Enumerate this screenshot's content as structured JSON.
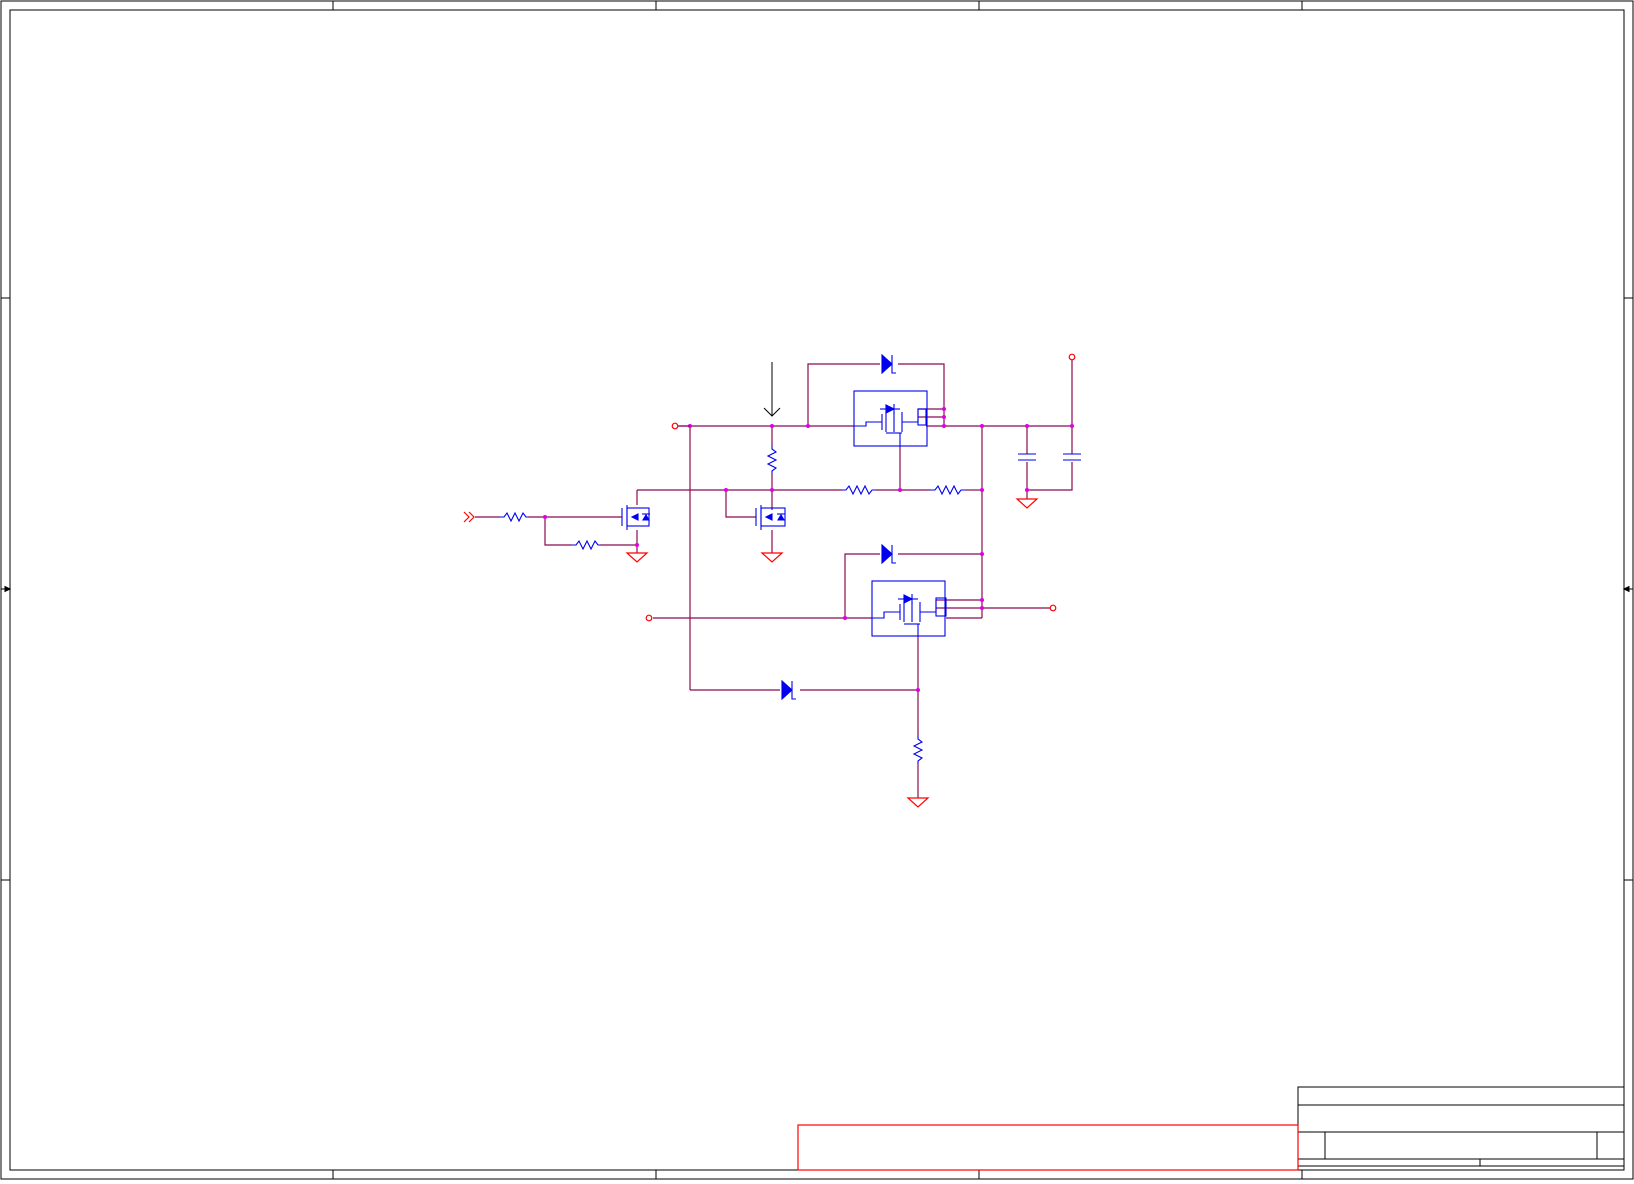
{
  "colors": {
    "wire": "#8b0a50",
    "junction": "#e000e0",
    "component": "#0000ee",
    "power": "#ff0000",
    "frame": "#000000",
    "annotation": "#000000"
  },
  "frame": {
    "zone_markers": {
      "columns": 5,
      "rows": 4
    }
  },
  "title_block": {
    "notice_box_color": "#ff0000",
    "fields": []
  },
  "components": [
    {
      "id": "q1",
      "kind": "power-mosfet-module"
    },
    {
      "id": "q2",
      "kind": "power-mosfet-module"
    },
    {
      "id": "q3",
      "kind": "n-mosfet"
    },
    {
      "id": "q4",
      "kind": "n-mosfet"
    },
    {
      "id": "d1",
      "kind": "zener-diode"
    },
    {
      "id": "d2",
      "kind": "zener-diode"
    },
    {
      "id": "d3",
      "kind": "zener-diode"
    },
    {
      "id": "r1",
      "kind": "resistor"
    },
    {
      "id": "r2",
      "kind": "resistor"
    },
    {
      "id": "r3",
      "kind": "resistor"
    },
    {
      "id": "r4",
      "kind": "resistor"
    },
    {
      "id": "r5",
      "kind": "resistor"
    },
    {
      "id": "r6",
      "kind": "resistor"
    },
    {
      "id": "c1",
      "kind": "capacitor"
    },
    {
      "id": "c2",
      "kind": "capacitor"
    }
  ]
}
